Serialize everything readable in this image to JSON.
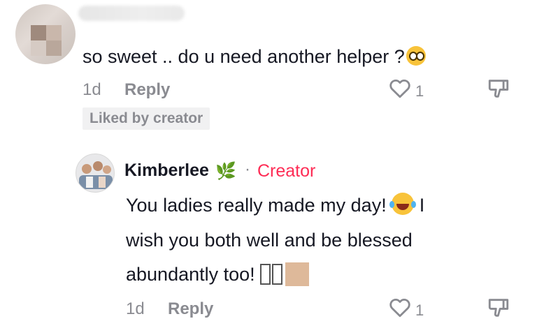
{
  "comment": {
    "text": "so sweet .. do u need another helper ?",
    "emoji": "pleading-face-icon",
    "time": "1d",
    "reply_label": "Reply",
    "like_count": "1",
    "liked_badge": "Liked by creator"
  },
  "reply": {
    "author": "Kimberlee",
    "author_emoji": "🌿",
    "separator": "·",
    "tag": "Creator",
    "text_line1": "You ladies really made my day!",
    "text_line1_after": "I",
    "text_line2": "wish you both well and be blessed",
    "text_line3": "abundantly too!",
    "time": "1d",
    "reply_label": "Reply",
    "like_count": "1"
  },
  "icons": {
    "like": "heart-outline-icon",
    "dislike": "thumbs-down-icon",
    "laugh": "face-with-tears-of-joy-icon",
    "tofu": "missing-glyph-boxes",
    "skin_tone": "skin-tone-modifier"
  },
  "colors": {
    "text": "#161823",
    "muted": "#8a8b91",
    "creator": "#fe2c55",
    "badge_bg": "#f1f1f2"
  }
}
